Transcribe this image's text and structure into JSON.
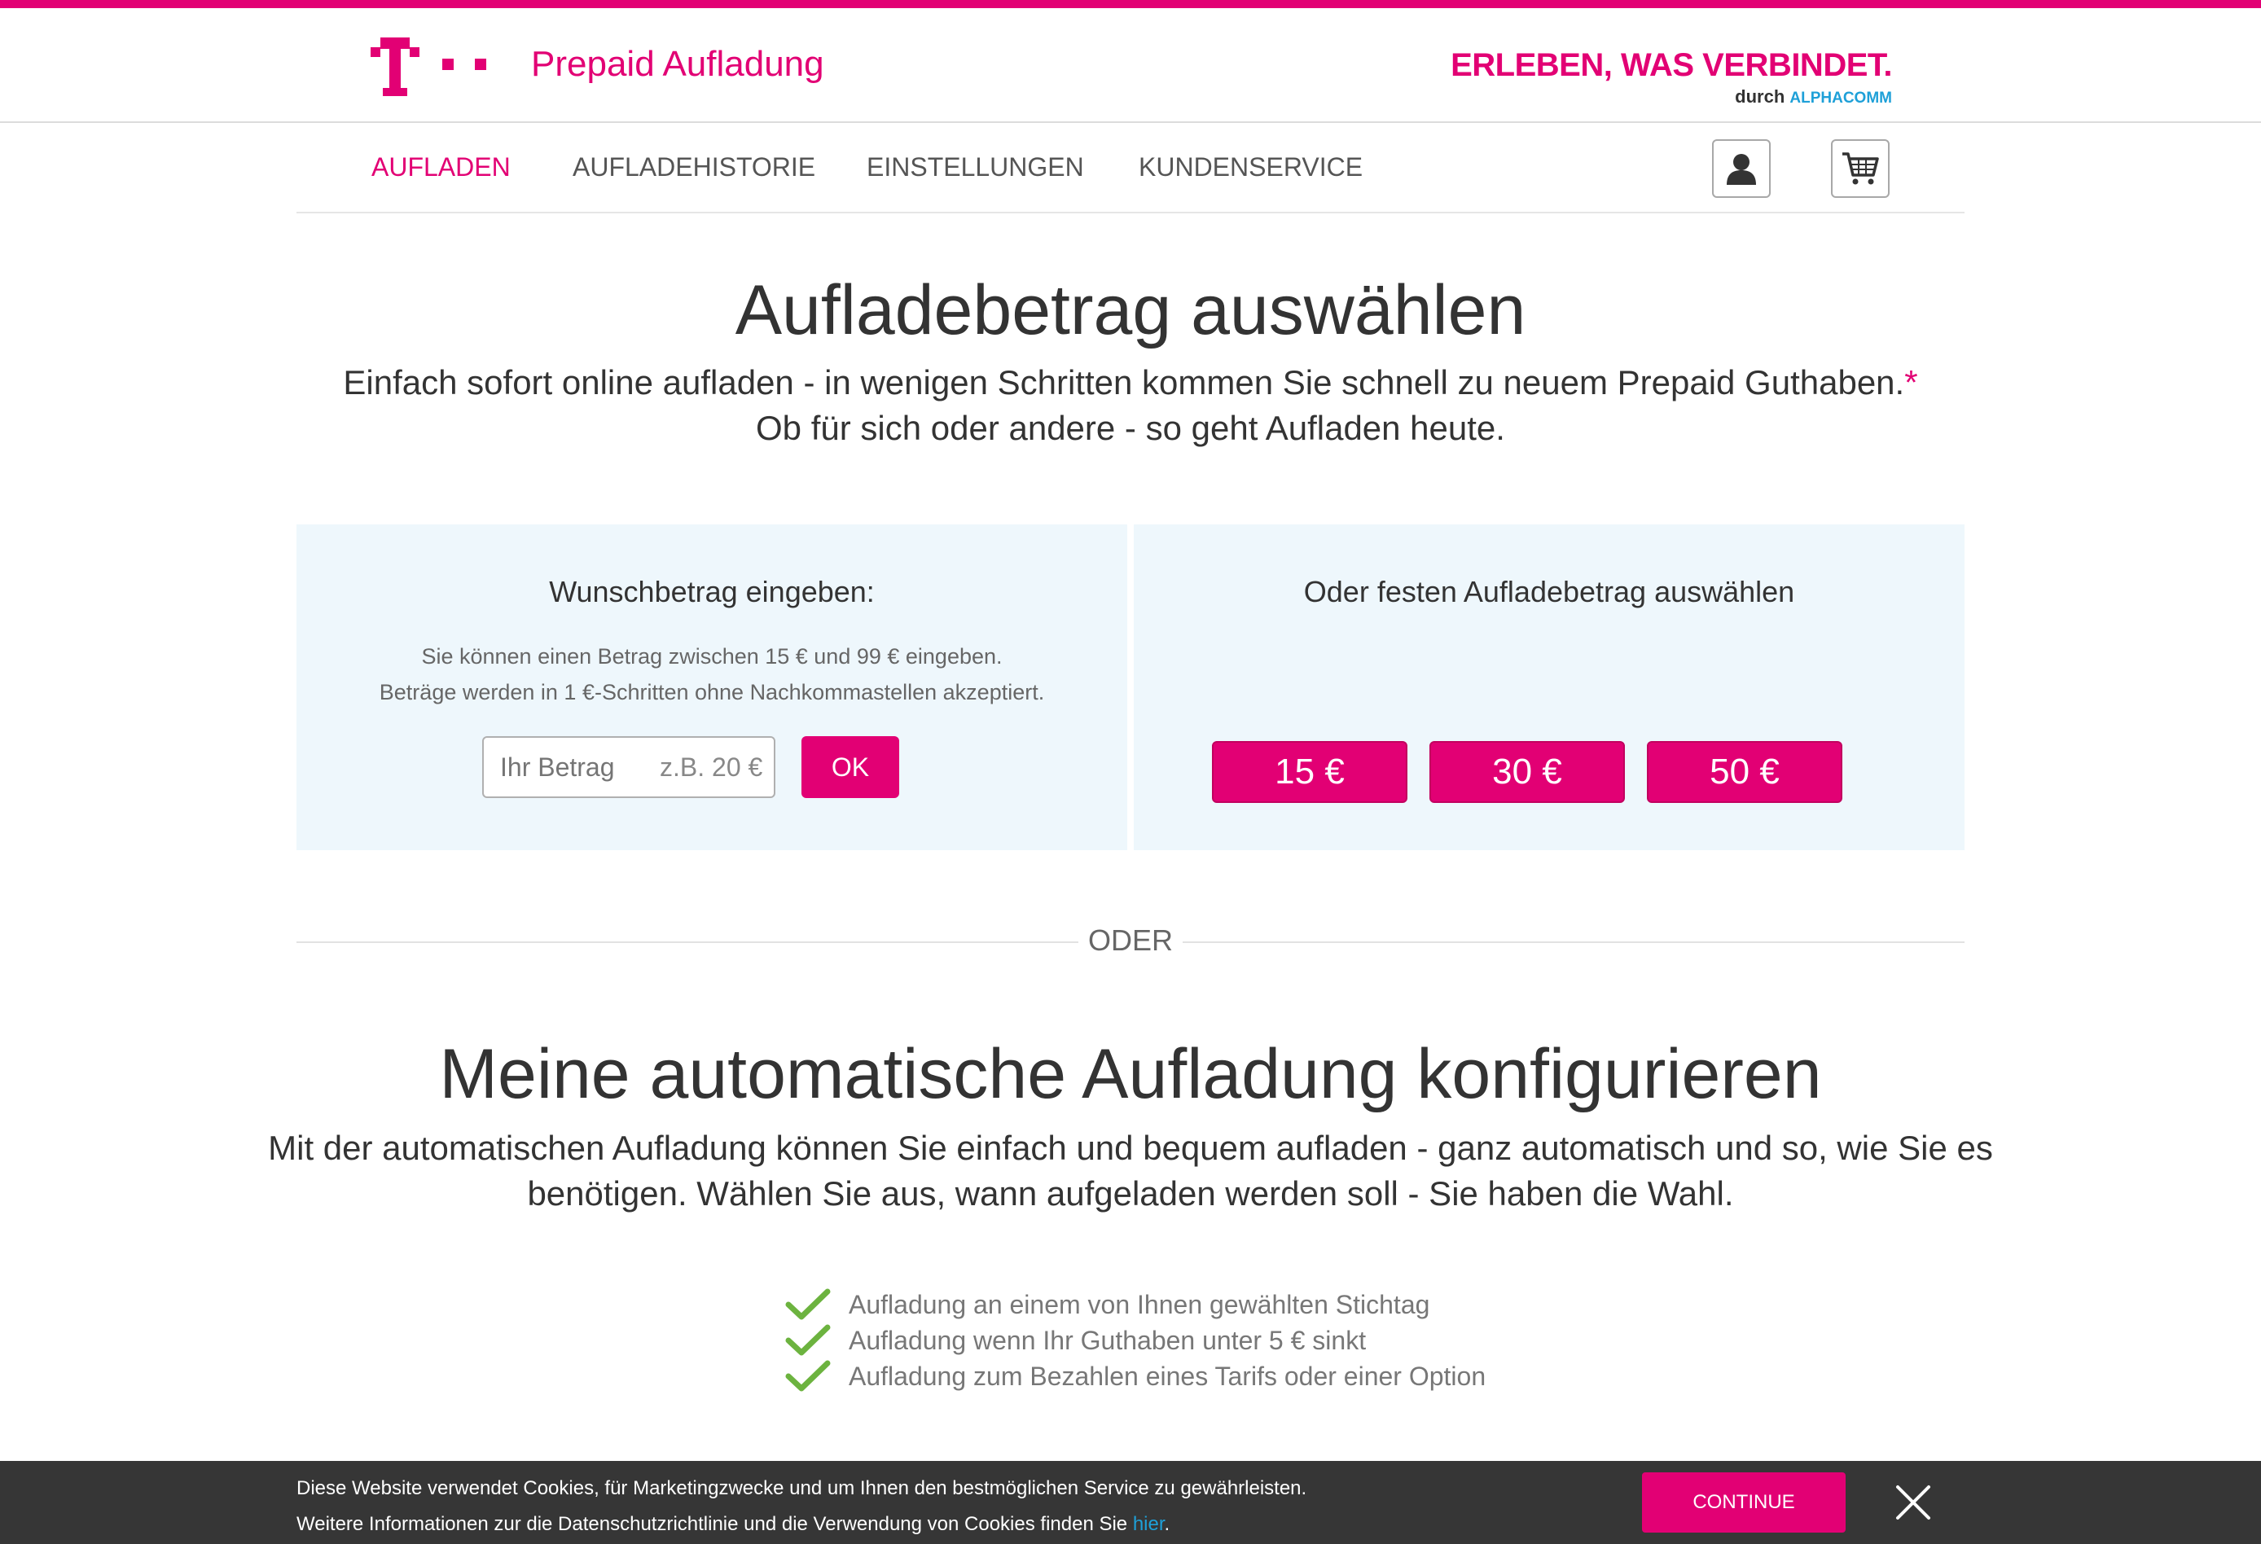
{
  "brand": {
    "title": "Prepaid Aufladung",
    "claim_main": "ERLEBEN, WAS VERBINDET.",
    "claim_by": "durch",
    "claim_partner": "ALPHACOMM",
    "color": "#e20074"
  },
  "nav": {
    "items": [
      {
        "label": "AUFLADEN",
        "active": true
      },
      {
        "label": "AUFLADEHISTORIE",
        "active": false
      },
      {
        "label": "EINSTELLUNGEN",
        "active": false
      },
      {
        "label": "KUNDENSERVICE",
        "active": false
      }
    ],
    "account_icon": "user-icon",
    "cart_icon": "cart-icon"
  },
  "hero": {
    "title": "Aufladebetrag auswählen",
    "line1": "Einfach sofort online aufladen - in wenigen Schritten kommen Sie schnell zu neuem Prepaid Guthaben.",
    "line1_star": "*",
    "line2": "Ob für sich oder andere - so geht Aufladen heute."
  },
  "custom_amount": {
    "title": "Wunschbetrag eingeben:",
    "info1": "Sie können einen Betrag zwischen 15 € und 99 € eingeben.",
    "info2": "Beträge werden in 1 €-Schritten ohne Nachkommastellen akzeptiert.",
    "placeholder": "Ihr Betrag",
    "hint": "z.B. 20 €",
    "ok_label": "OK"
  },
  "fixed_amount": {
    "title": "Oder festen Aufladebetrag auswählen",
    "options": [
      "15 €",
      "30 €",
      "50 €"
    ]
  },
  "divider": {
    "label": "ODER"
  },
  "auto_topup": {
    "title": "Meine automatische Aufladung konfigurieren",
    "line1": "Mit der automatischen Aufladung können Sie einfach und bequem aufladen - ganz automatisch und so, wie Sie es",
    "line2": "benötigen. Wählen Sie aus, wann aufgeladen werden soll - Sie haben die Wahl.",
    "features": [
      "Aufladung an einem von Ihnen gewählten Stichtag",
      "Aufladung wenn Ihr Guthaben unter 5 € sinkt",
      "Aufladung zum Bezahlen eines Tarifs oder einer Option"
    ],
    "check_color": "#6cb33f"
  },
  "cookie_banner": {
    "line1": "Diese Website verwendet Cookies, für Marketingzwecke und um Ihnen den bestmöglichen Service zu gewährleisten.",
    "line2_prefix": "Weitere Informationen zur die Datenschutzrichtlinie und die Verwendung von Cookies finden Sie",
    "link_label": "hier",
    "line2_suffix": ".",
    "continue_label": "CONTINUE",
    "close_icon": "close-icon"
  }
}
